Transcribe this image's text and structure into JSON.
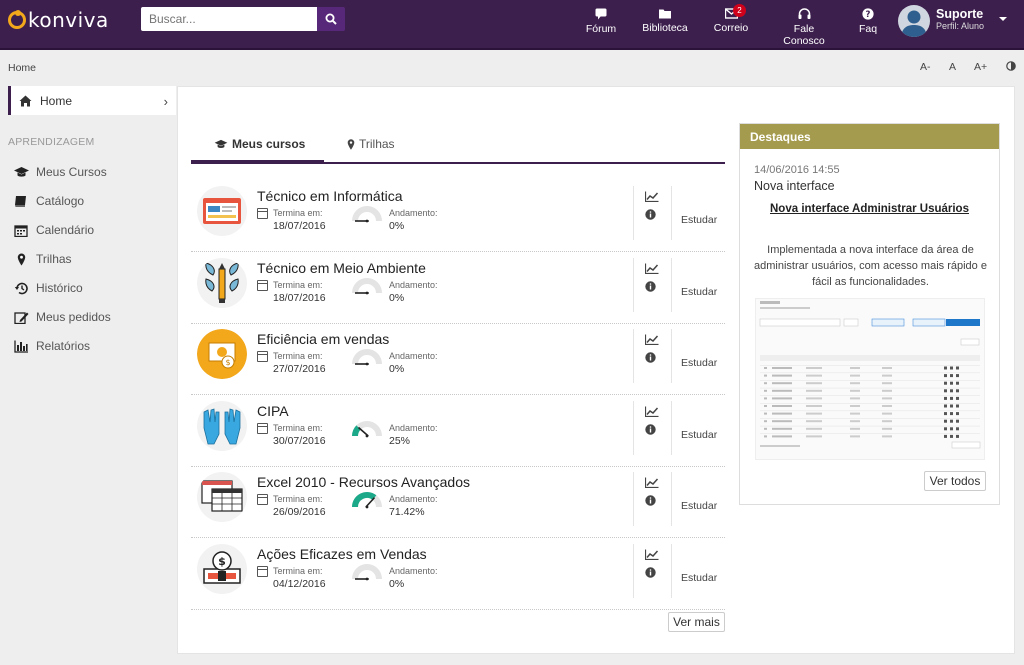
{
  "brand": {
    "name": "konviva",
    "accent": "#3d1f4e",
    "highlight": "#a59b4e"
  },
  "search": {
    "placeholder": "Buscar..."
  },
  "topnav": [
    {
      "label": "Fórum",
      "icon": "chat-bubble-icon"
    },
    {
      "label": "Biblioteca",
      "icon": "folder-icon"
    },
    {
      "label": "Correio",
      "icon": "envelope-icon",
      "badge": "2"
    },
    {
      "label": "Fale Conosco",
      "icon": "headset-icon"
    },
    {
      "label": "Faq",
      "icon": "question-circle-icon"
    }
  ],
  "user": {
    "name": "Suporte",
    "profile": "Perfil: Aluno"
  },
  "breadcrumb": "Home",
  "font_controls": [
    "A-",
    "A",
    "A+"
  ],
  "sidebar": {
    "home_label": "Home",
    "section": "APRENDIZAGEM",
    "items": [
      {
        "label": "Meus Cursos",
        "icon": "graduation-cap-icon"
      },
      {
        "label": "Catálogo",
        "icon": "book-icon"
      },
      {
        "label": "Calendário",
        "icon": "calendar-icon"
      },
      {
        "label": "Trilhas",
        "icon": "map-marker-icon"
      },
      {
        "label": "Histórico",
        "icon": "history-icon"
      },
      {
        "label": "Meus pedidos",
        "icon": "edit-icon"
      },
      {
        "label": "Relatórios",
        "icon": "bar-chart-icon"
      }
    ]
  },
  "tabs": [
    {
      "label": "Meus cursos",
      "icon": "graduation-cap-icon",
      "active": true
    },
    {
      "label": "Trilhas",
      "icon": "map-marker-icon",
      "active": false
    }
  ],
  "course_labels": {
    "ends": "Termina em:",
    "progress": "Andamento:",
    "study": "Estudar"
  },
  "courses": [
    {
      "title": "Técnico em Informática",
      "end_date": "18/07/2016",
      "progress": "0%",
      "progress_value": 0,
      "icon": "browser-window-icon"
    },
    {
      "title": "Técnico em Meio Ambiente",
      "end_date": "18/07/2016",
      "progress": "0%",
      "progress_value": 0,
      "icon": "pencil-leaves-icon"
    },
    {
      "title": "Eficiência em vendas",
      "end_date": "27/07/2016",
      "progress": "0%",
      "progress_value": 0,
      "icon": "money-icon"
    },
    {
      "title": "CIPA",
      "end_date": "30/07/2016",
      "progress": "25%",
      "progress_value": 25,
      "icon": "gloves-icon"
    },
    {
      "title": "Excel 2010 - Recursos Avançados",
      "end_date": "26/09/2016",
      "progress": "71.42%",
      "progress_value": 71.42,
      "icon": "spreadsheet-icon"
    },
    {
      "title": "Ações Eficazes em Vendas",
      "end_date": "04/12/2016",
      "progress": "0%",
      "progress_value": 0,
      "icon": "dollar-coin-icon"
    }
  ],
  "more_button": "Ver mais",
  "highlights": {
    "title": "Destaques",
    "date": "14/06/2016 14:55",
    "subtitle": "Nova interface",
    "link": "Nova interface Administrar Usuários",
    "description": "Implementada a nova interface da área de administrar usuários, com acesso mais rápido e fácil as funcionalidades.",
    "view_all": "Ver todos"
  }
}
